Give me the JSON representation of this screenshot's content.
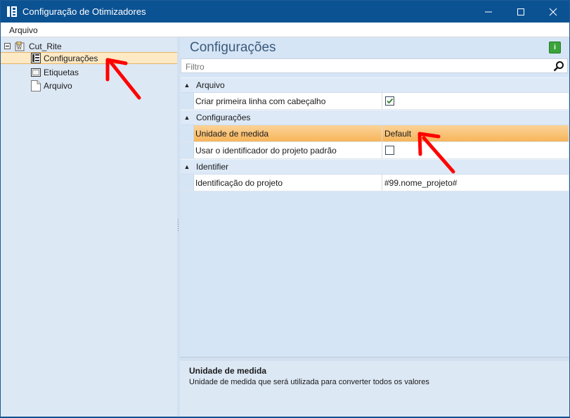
{
  "window": {
    "title": "Configuração de Otimizadores"
  },
  "menu": {
    "items": [
      "Arquivo"
    ]
  },
  "tree": {
    "root": {
      "label": "Cut_Rite",
      "expander": "⊟"
    },
    "children": [
      {
        "label": "Configurações",
        "selected": true,
        "icon": "settings-page-icon"
      },
      {
        "label": "Etiquetas",
        "selected": false,
        "icon": "labels-icon"
      },
      {
        "label": "Arquivo",
        "selected": false,
        "icon": "file-icon"
      }
    ]
  },
  "main": {
    "title": "Configurações",
    "info_button": "i",
    "filter_placeholder": "Filtro"
  },
  "grid": {
    "categories": [
      {
        "label": "Arquivo",
        "properties": [
          {
            "name": "Criar primeira linha com cabeçalho",
            "type": "checkbox",
            "checked": true
          }
        ]
      },
      {
        "label": "Configurações",
        "properties": [
          {
            "name": "Unidade de medida",
            "type": "text",
            "value": "Default",
            "highlighted": true
          },
          {
            "name": "Usar o identificador do projeto padrão",
            "type": "checkbox",
            "checked": false
          }
        ]
      },
      {
        "label": "Identifier",
        "properties": [
          {
            "name": "Identificação do projeto",
            "type": "text",
            "value": "#99.nome_projeto#"
          }
        ]
      }
    ]
  },
  "description": {
    "title": "Unidade de medida",
    "text": "Unidade de medida que será utilizada para converter todos os valores"
  },
  "colors": {
    "titlebar": "#0b5293",
    "selection": "#fde9c4",
    "highlight": "#f7b55a",
    "annotation_arrow": "#ff0000"
  }
}
